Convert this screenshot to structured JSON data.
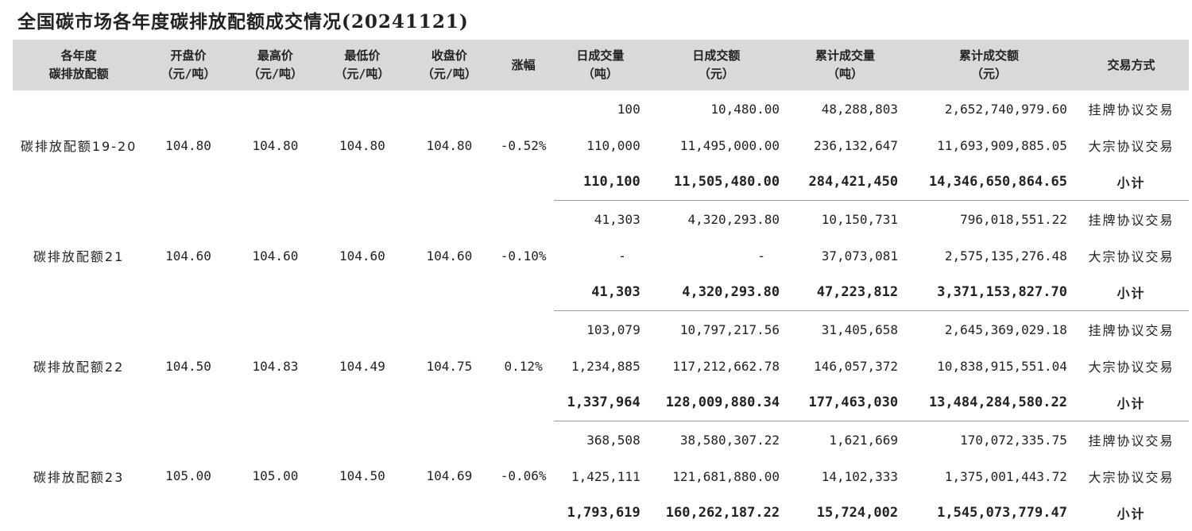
{
  "title": "全国碳市场各年度碳排放配额成交情况(20241121)",
  "headers": [
    {
      "l1": "各年度",
      "l2": "碳排放配额"
    },
    {
      "l1": "开盘价",
      "l2": "（元/吨）"
    },
    {
      "l1": "最高价",
      "l2": "（元/吨）"
    },
    {
      "l1": "最低价",
      "l2": "（元/吨）"
    },
    {
      "l1": "收盘价",
      "l2": "（元/吨）"
    },
    {
      "l1": "涨幅",
      "l2": ""
    },
    {
      "l1": "日成交量",
      "l2": "（吨）"
    },
    {
      "l1": "日成交额",
      "l2": "（元）"
    },
    {
      "l1": "累计成交量",
      "l2": "（吨）"
    },
    {
      "l1": "累计成交额",
      "l2": "（元）"
    },
    {
      "l1": "交易方式",
      "l2": ""
    }
  ],
  "groups": [
    {
      "name": "碳排放配额19-20",
      "open": "104.80",
      "high": "104.80",
      "low": "104.80",
      "close": "104.80",
      "change": "-0.52%",
      "rows": [
        {
          "daily_vol": "100",
          "daily_amt": "10,480.00",
          "cum_vol": "48,288,803",
          "cum_amt": "2,652,740,979.60",
          "method": "挂牌协议交易"
        },
        {
          "daily_vol": "110,000",
          "daily_amt": "11,495,000.00",
          "cum_vol": "236,132,647",
          "cum_amt": "11,693,909,885.05",
          "method": "大宗协议交易"
        },
        {
          "daily_vol": "110,100",
          "daily_amt": "11,505,480.00",
          "cum_vol": "284,421,450",
          "cum_amt": "14,346,650,864.65",
          "method": "小计"
        }
      ]
    },
    {
      "name": "碳排放配额21",
      "open": "104.60",
      "high": "104.60",
      "low": "104.60",
      "close": "104.60",
      "change": "-0.10%",
      "rows": [
        {
          "daily_vol": "41,303",
          "daily_amt": "4,320,293.80",
          "cum_vol": "10,150,731",
          "cum_amt": "796,018,551.22",
          "method": "挂牌协议交易"
        },
        {
          "daily_vol": "-",
          "daily_amt": "-",
          "cum_vol": "37,073,081",
          "cum_amt": "2,575,135,276.48",
          "method": "大宗协议交易"
        },
        {
          "daily_vol": "41,303",
          "daily_amt": "4,320,293.80",
          "cum_vol": "47,223,812",
          "cum_amt": "3,371,153,827.70",
          "method": "小计"
        }
      ]
    },
    {
      "name": "碳排放配额22",
      "open": "104.50",
      "high": "104.83",
      "low": "104.49",
      "close": "104.75",
      "change": "0.12%",
      "rows": [
        {
          "daily_vol": "103,079",
          "daily_amt": "10,797,217.56",
          "cum_vol": "31,405,658",
          "cum_amt": "2,645,369,029.18",
          "method": "挂牌协议交易"
        },
        {
          "daily_vol": "1,234,885",
          "daily_amt": "117,212,662.78",
          "cum_vol": "146,057,372",
          "cum_amt": "10,838,915,551.04",
          "method": "大宗协议交易"
        },
        {
          "daily_vol": "1,337,964",
          "daily_amt": "128,009,880.34",
          "cum_vol": "177,463,030",
          "cum_amt": "13,484,284,580.22",
          "method": "小计"
        }
      ]
    },
    {
      "name": "碳排放配额23",
      "open": "105.00",
      "high": "105.00",
      "low": "104.50",
      "close": "104.69",
      "change": "-0.06%",
      "rows": [
        {
          "daily_vol": "368,508",
          "daily_amt": "38,580,307.22",
          "cum_vol": "1,621,669",
          "cum_amt": "170,072,335.75",
          "method": "挂牌协议交易"
        },
        {
          "daily_vol": "1,425,111",
          "daily_amt": "121,681,880.00",
          "cum_vol": "14,102,333",
          "cum_amt": "1,375,001,443.72",
          "method": "大宗协议交易"
        },
        {
          "daily_vol": "1,793,619",
          "daily_amt": "160,262,187.22",
          "cum_vol": "15,724,002",
          "cum_amt": "1,545,073,779.47",
          "method": "小计"
        }
      ]
    }
  ]
}
